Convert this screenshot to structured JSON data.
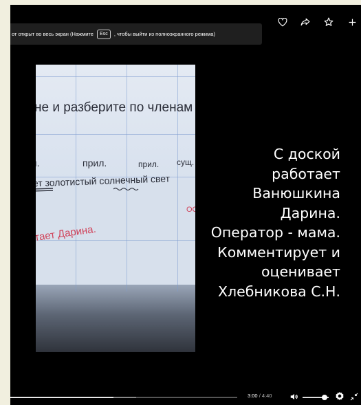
{
  "banner": {
    "text_before": "от открыт во весь экран (Нажмите",
    "key": "Esc",
    "text_after": ", чтобы выйти из полноэкранного режима)"
  },
  "top_icons": [
    "heart-icon",
    "share-icon",
    "star-icon",
    "plus-icon"
  ],
  "board": {
    "line1": "не и  разберите по членам предл",
    "line2_words": [
      "п.",
      "прил.",
      "прил.",
      "сущ."
    ],
    "line3": "ает золотистый солнечный свет",
    "line4": "ОС",
    "line5": "тает Дарина."
  },
  "caption": [
    "С доской",
    "работает",
    "Ванюшкина",
    "Дарина.",
    "Оператор - мама.",
    "Комментирует и",
    "оценивает",
    "Хлебникова С.Н."
  ],
  "controls": {
    "current_time": "3:00",
    "separator": " / ",
    "duration": "4:40",
    "progress": 0.643,
    "volume": 0.85
  }
}
